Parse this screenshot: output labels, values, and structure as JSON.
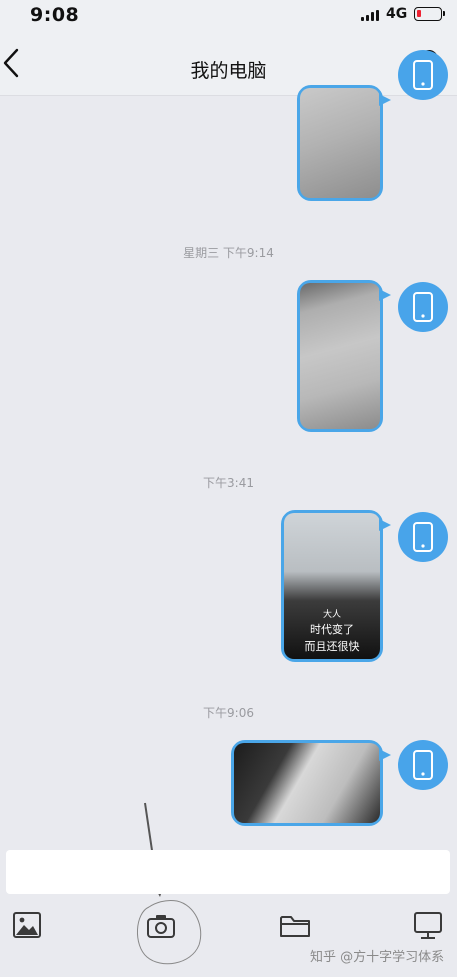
{
  "status_bar": {
    "time": "9:08",
    "network": "4G"
  },
  "nav": {
    "title": "我的电脑"
  },
  "messages": [
    {
      "type": "timestamp",
      "text": "星期三 下午9:14"
    },
    {
      "type": "timestamp",
      "text": "下午3:41"
    },
    {
      "type": "image",
      "caption_lines": [
        "大人",
        "时代变了",
        "而且还很快"
      ]
    },
    {
      "type": "timestamp",
      "text": "下午9:06"
    }
  ],
  "toolbar": {
    "items": [
      "image-icon",
      "camera-icon",
      "folder-icon",
      "computer-icon"
    ]
  },
  "watermark": "知乎 @方十字学习体系",
  "colors": {
    "accent": "#4aa6e8",
    "background": "#e9eaef"
  }
}
